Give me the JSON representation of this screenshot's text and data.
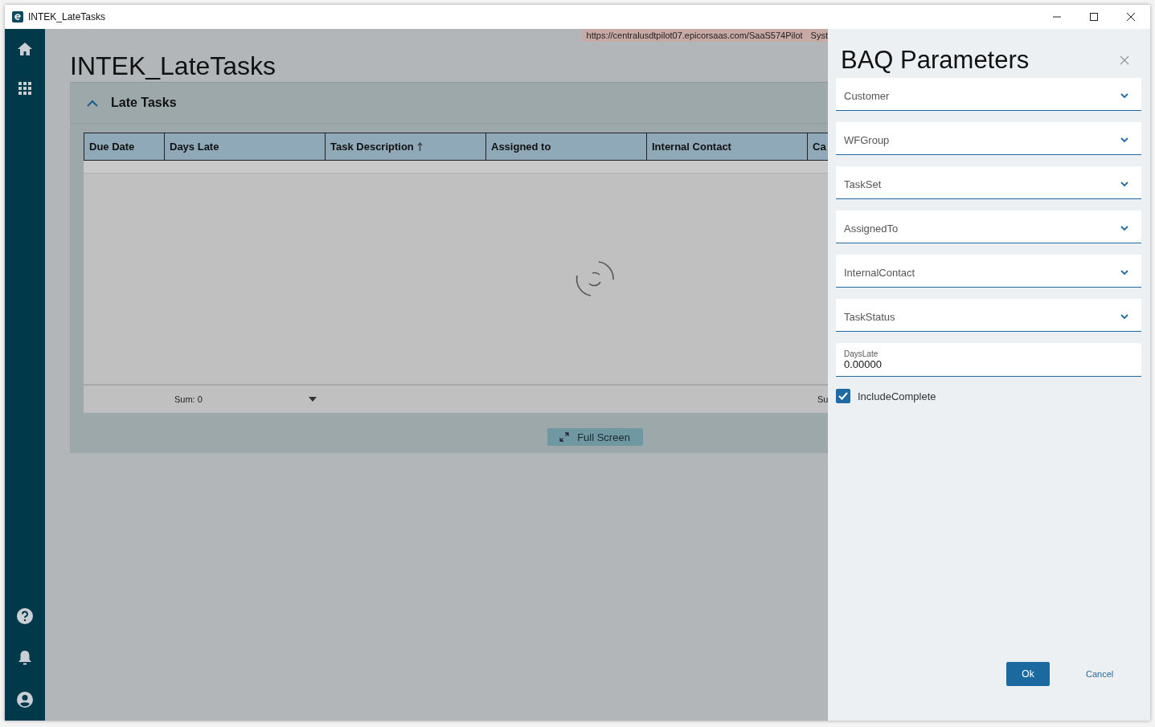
{
  "window": {
    "title": "INTEK_LateTasks"
  },
  "url_banner": {
    "url": "https://centralusdtpilot07.epicorsaas.com/SaaS574Pilot",
    "text_2": "Syst"
  },
  "page_title": "INTEK_LateTasks",
  "card": {
    "title": "Late Tasks",
    "expanded": true,
    "loading": true,
    "columns": [
      {
        "label": "Due Date",
        "sorted": false
      },
      {
        "label": "Days Late",
        "sorted": false,
        "sum": "Sum: 0",
        "sum_menu": true
      },
      {
        "label": "Task Description",
        "sorted": true
      },
      {
        "label": "Assigned to",
        "sorted": false
      },
      {
        "label": "Internal Contact",
        "sorted": false
      },
      {
        "label": "Ca",
        "sorted": false,
        "sum": "Su",
        "sum_menu": false
      }
    ],
    "full_screen_button": "Full Screen"
  },
  "panel": {
    "title": "BAQ Parameters",
    "fields": [
      {
        "kind": "dropdown",
        "label": "Customer"
      },
      {
        "kind": "dropdown",
        "label": "WFGroup"
      },
      {
        "kind": "dropdown",
        "label": "TaskSet"
      },
      {
        "kind": "dropdown",
        "label": "AssignedTo"
      },
      {
        "kind": "dropdown",
        "label": "InternalContact"
      },
      {
        "kind": "dropdown",
        "label": "TaskStatus"
      },
      {
        "kind": "number",
        "label": "DaysLate",
        "value": "0.00000"
      },
      {
        "kind": "checkbox",
        "label": "IncludeComplete",
        "checked": true
      }
    ],
    "ok_button": "Ok",
    "cancel_button": "Cancel"
  }
}
